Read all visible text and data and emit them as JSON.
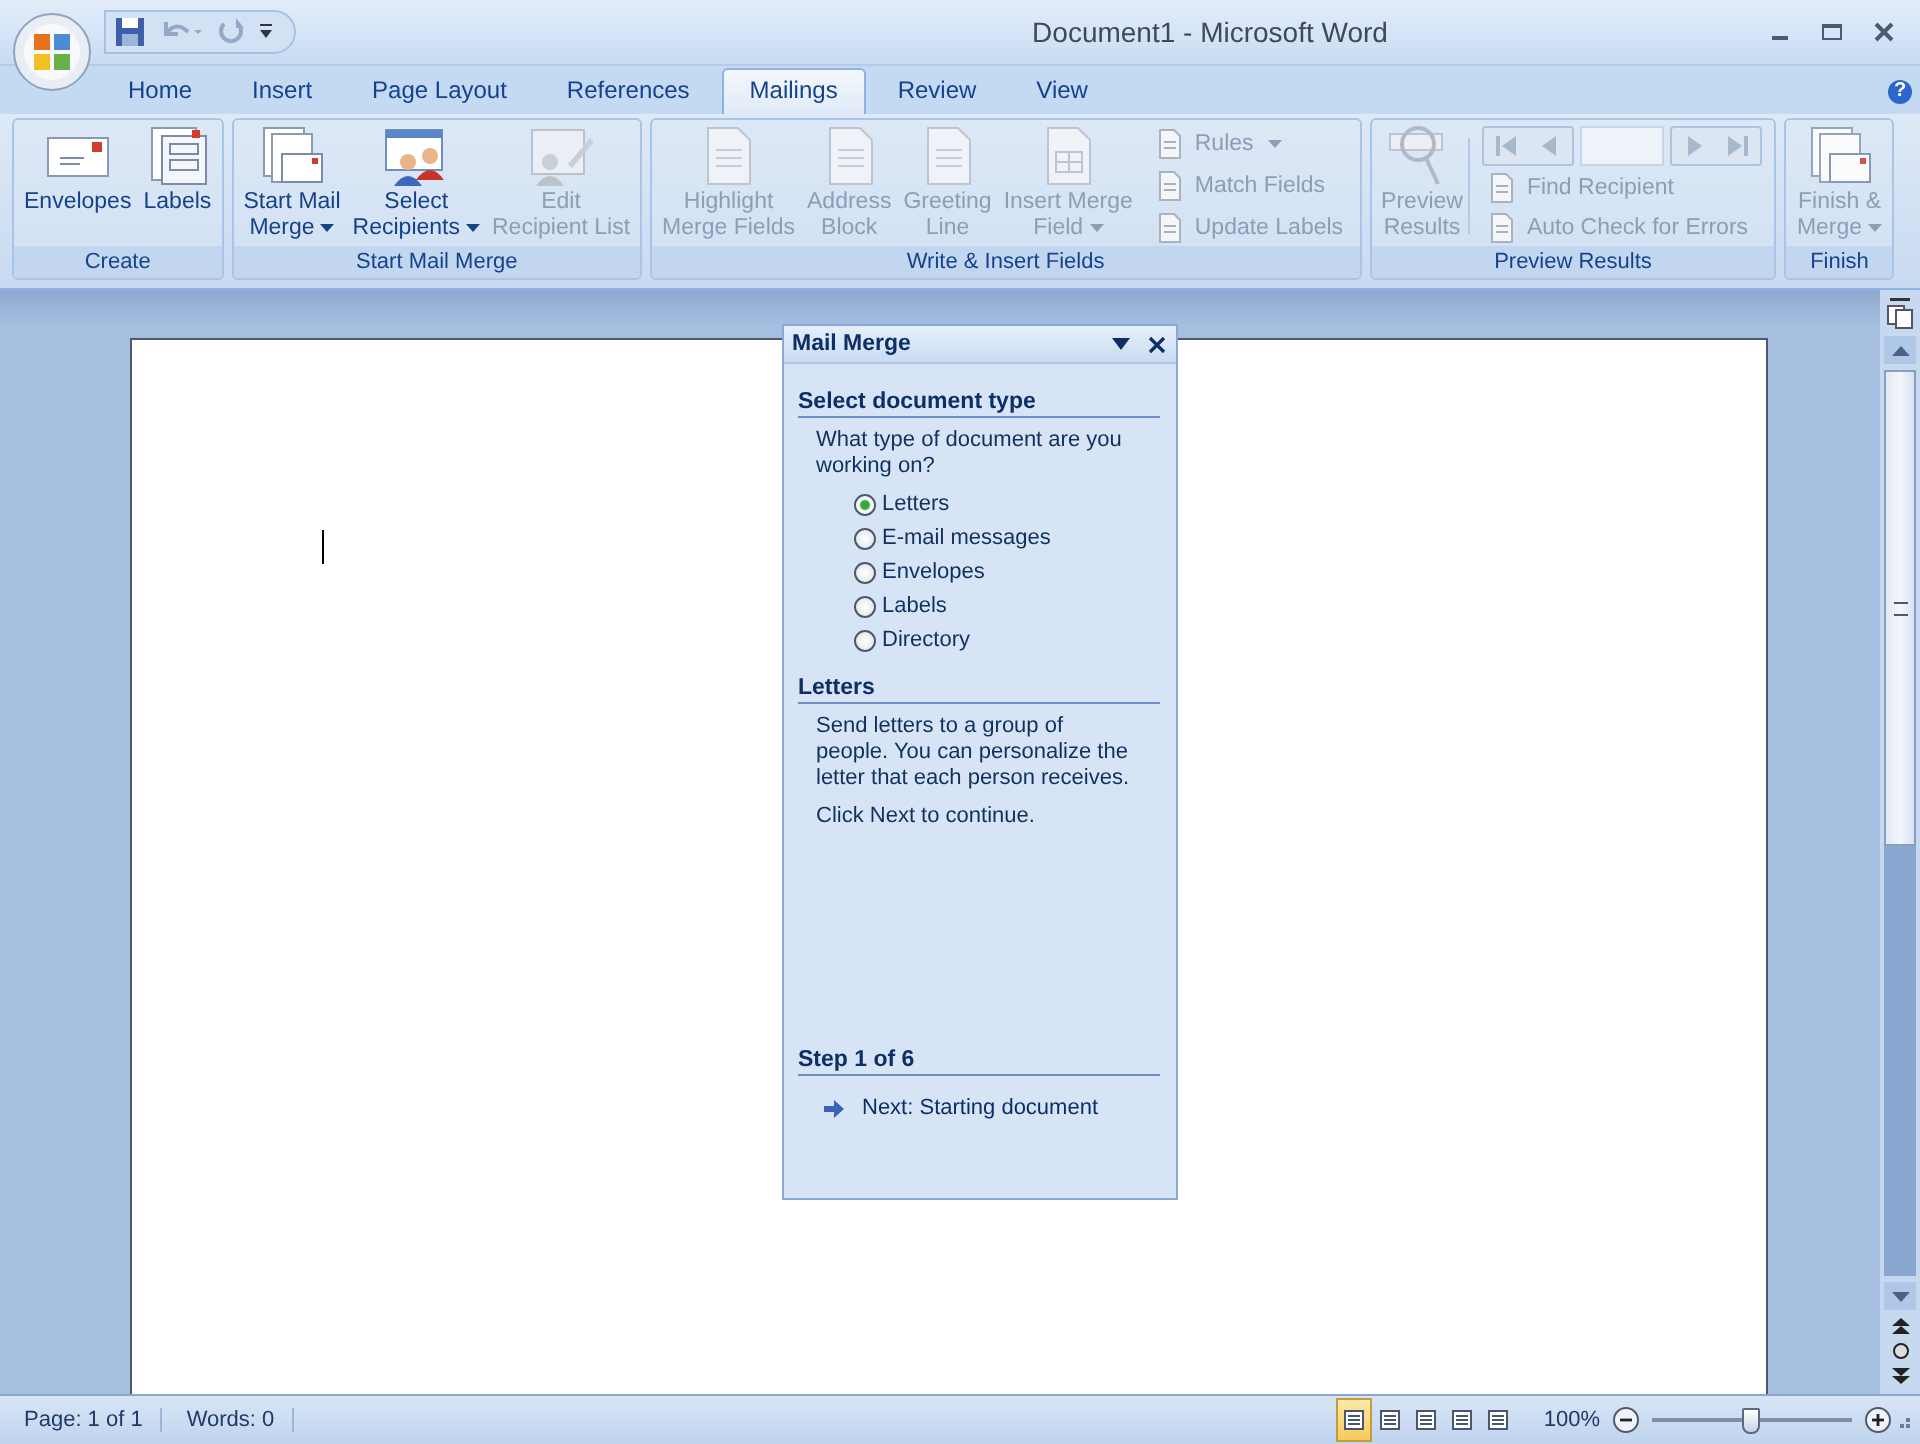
{
  "window": {
    "title": "Document1 - Microsoft Word"
  },
  "tabs": [
    {
      "label": "Home",
      "selected": false
    },
    {
      "label": "Insert",
      "selected": false
    },
    {
      "label": "Page Layout",
      "selected": false
    },
    {
      "label": "References",
      "selected": false
    },
    {
      "label": "Mailings",
      "selected": true
    },
    {
      "label": "Review",
      "selected": false
    },
    {
      "label": "View",
      "selected": false
    }
  ],
  "help_button": "?",
  "ribbon": {
    "groups": [
      {
        "label": "Create",
        "items": [
          {
            "kind": "large",
            "lines": [
              "Envelopes"
            ],
            "dropdown": false,
            "disabled": false
          },
          {
            "kind": "large",
            "lines": [
              "Labels"
            ],
            "dropdown": false,
            "disabled": false
          }
        ]
      },
      {
        "label": "Start Mail Merge",
        "items": [
          {
            "kind": "large",
            "lines": [
              "Start Mail",
              "Merge"
            ],
            "dropdown": true,
            "disabled": false
          },
          {
            "kind": "large",
            "lines": [
              "Select",
              "Recipients"
            ],
            "dropdown": true,
            "disabled": false
          },
          {
            "kind": "large",
            "lines": [
              "Edit",
              "Recipient List"
            ],
            "dropdown": false,
            "disabled": true
          }
        ]
      },
      {
        "label": "Write & Insert Fields",
        "items": [
          {
            "kind": "large",
            "lines": [
              "Highlight",
              "Merge Fields"
            ],
            "dropdown": false,
            "disabled": true
          },
          {
            "kind": "large",
            "lines": [
              "Address",
              "Block"
            ],
            "dropdown": false,
            "disabled": true
          },
          {
            "kind": "large",
            "lines": [
              "Greeting",
              "Line"
            ],
            "dropdown": false,
            "disabled": true
          },
          {
            "kind": "large",
            "lines": [
              "Insert Merge",
              "Field"
            ],
            "dropdown": true,
            "disabled": true
          },
          {
            "kind": "stack",
            "items": [
              {
                "kind": "button",
                "label": "Rules",
                "dropdown": true,
                "disabled": true
              },
              {
                "kind": "button",
                "label": "Match Fields",
                "dropdown": false,
                "disabled": true
              },
              {
                "kind": "button",
                "label": "Update Labels",
                "dropdown": false,
                "disabled": true
              }
            ]
          }
        ]
      },
      {
        "label": "Preview Results",
        "items": [
          {
            "kind": "large",
            "lines": [
              "Preview",
              "Results"
            ],
            "dropdown": false,
            "disabled": true
          },
          {
            "kind": "stack",
            "items": [
              {
                "kind": "nav",
                "disabled": true
              },
              {
                "kind": "button",
                "label": "Find Recipient",
                "dropdown": false,
                "disabled": true
              },
              {
                "kind": "button",
                "label": "Auto Check for Errors",
                "dropdown": false,
                "disabled": true
              }
            ]
          }
        ]
      },
      {
        "label": "Finish",
        "items": [
          {
            "kind": "large",
            "lines": [
              "Finish &",
              "Merge"
            ],
            "dropdown": true,
            "disabled": true
          }
        ]
      }
    ]
  },
  "task_pane": {
    "title": "Mail Merge",
    "sections": [
      {
        "heading": "Select document type",
        "paragraphs": [
          "What type of document are you working on?"
        ],
        "options": [
          {
            "label": "Letters",
            "selected": true
          },
          {
            "label": "E-mail messages",
            "selected": false
          },
          {
            "label": "Envelopes",
            "selected": false
          },
          {
            "label": "Labels",
            "selected": false
          },
          {
            "label": "Directory",
            "selected": false
          }
        ]
      },
      {
        "heading": "Letters",
        "paragraphs": [
          "Send letters to a group of people. You can personalize the letter that each person receives.",
          "Click Next to continue."
        ]
      }
    ],
    "step": {
      "heading": "Step 1 of 6",
      "link": "Next: Starting document"
    }
  },
  "status_bar": {
    "page": "Page: 1 of 1",
    "words": "Words: 0",
    "views": [
      {
        "selected": true
      },
      {
        "selected": false
      },
      {
        "selected": false
      },
      {
        "selected": false
      },
      {
        "selected": false
      }
    ],
    "zoom": "100%",
    "zoom_slider": {
      "level": 0.5
    }
  }
}
